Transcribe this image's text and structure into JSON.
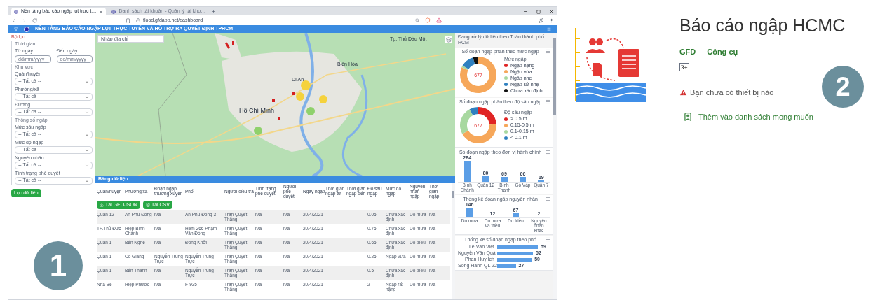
{
  "browser": {
    "tabs": [
      {
        "label": "Nền tảng báo cáo ngập lụt trực t…",
        "selected": true
      },
      {
        "label": "Danh sách tài khoản - Quản lý tài kho…",
        "selected": false
      }
    ],
    "url": "flood.gfdapp.net/dashboard"
  },
  "header": {
    "title": "NỀN TẢNG BÁO CÁO NGẬP LỤT TRỰC TUYẾN VÀ HỖ TRỢ RA QUYẾT ĐỊNH TPHCM"
  },
  "filters": {
    "title": "Bộ lọc",
    "groups": [
      {
        "title": "Thời gian",
        "kind": "dates",
        "dates": [
          {
            "label": "Từ ngày",
            "placeholder": "dd/mm/yyyy"
          },
          {
            "label": "Đến ngày",
            "placeholder": "dd/mm/yyyy"
          }
        ]
      },
      {
        "title": "Khu vực",
        "kind": "selects",
        "selects": [
          {
            "label": "Quận/huyện",
            "value": "-- Tất cả --"
          },
          {
            "label": "Phường/xã",
            "value": "-- Tất cả --"
          },
          {
            "label": "Đường",
            "value": "-- Tất cả --"
          }
        ]
      },
      {
        "title": "Thông số ngập",
        "kind": "selects",
        "selects": [
          {
            "label": "Mức sâu ngập",
            "value": "-- Tất cả --"
          },
          {
            "label": "Mức độ ngập",
            "value": "-- Tất cả --"
          },
          {
            "label": "Nguyên nhân",
            "value": "-- Tất cả --"
          },
          {
            "label": "Tình trạng phê duyệt",
            "value": "-- Tất cả --"
          }
        ]
      }
    ],
    "button": "Lọc dữ liệu"
  },
  "map": {
    "search_placeholder": "Nhập địa chỉ",
    "places": [
      "Tp. Thủ Dầu Một",
      "Biên Hòa",
      "Dĩ An",
      "Hồ Chí Minh"
    ]
  },
  "table": {
    "title": "Bảng dữ liệu",
    "columns": [
      "Quận/huyện",
      "Phường/xã",
      "Đoạn ngập thường xuyên",
      "Phố",
      "Người điều tra",
      "Tình trạng phê duyệt",
      "Người phê duyệt",
      "Ngày ngập",
      "Thời gian ngập từ",
      "Thời gian ngập đến",
      "Độ sâu ngập",
      "Mức độ ngập",
      "Nguyên nhân ngập",
      "Thời gian ngập"
    ],
    "buttons": [
      "Tải GEOJSON",
      "Tải CSV"
    ],
    "rows": [
      [
        "Quận 12",
        "An Phú Đông",
        "n/a",
        "An Phú Đông 3",
        "Trần Quyết Thắng",
        "n/a",
        "n/a",
        "20/4/2021",
        "",
        "",
        "0.05",
        "Chưa xác định",
        "Do mưa",
        "n/a"
      ],
      [
        "TP.Thủ Đức",
        "Hiệp Bình Chánh",
        "n/a",
        "Hẻm 266 Phạm Văn Đồng",
        "Trần Quyết Thắng",
        "n/a",
        "n/a",
        "20/4/2021",
        "",
        "",
        "0.75",
        "Chưa xác định",
        "Do mưa",
        "n/a"
      ],
      [
        "Quận 1",
        "Bến Nghé",
        "n/a",
        "Đồng Khởi",
        "Trần Quyết Thắng",
        "n/a",
        "n/a",
        "20/4/2021",
        "",
        "",
        "0.65",
        "Chưa xác định",
        "Do triều",
        "n/a"
      ],
      [
        "Quận 1",
        "Cô Giang",
        "Nguyễn Trung Trực",
        "Nguyễn Trung Trực",
        "Trần Quyết Thắng",
        "n/a",
        "n/a",
        "20/4/2021",
        "",
        "",
        "0.25",
        "Ngập vừa",
        "Do mưa",
        "n/a"
      ],
      [
        "Quận 1",
        "Bến Thành",
        "n/a",
        "Nguyễn Trung Trực",
        "Trần Quyết Thắng",
        "n/a",
        "n/a",
        "20/4/2021",
        "",
        "",
        "0.5",
        "Chưa xác định",
        "Do triều",
        "n/a"
      ],
      [
        "Nhà Bè",
        "Hiệp Phước",
        "n/a",
        "F-935",
        "Trần Quyết Thắng",
        "n/a",
        "n/a",
        "20/4/2021",
        "",
        "",
        "2",
        "Ngập rất nặng",
        "Do mưa",
        "n/a"
      ]
    ]
  },
  "stats": {
    "title": "Đang xử lý dữ liệu theo Toàn thành phố HCM",
    "donuts": [
      {
        "legend_title": "Mức ngập",
        "center": "677",
        "chart_data": {
          "type": "donut",
          "title": "Số đoạn ngập phân theo mức ngập",
          "legend": "right",
          "categories": [
            "Ngập nặng",
            "Ngập vừa",
            "Ngập nhẹ",
            "Ngập rất nhẹ",
            "Chưa xác định"
          ],
          "colors": [
            "#e02424",
            "#f6a75a",
            "#a8d8a0",
            "#2f80c0",
            "#111111"
          ],
          "values": [
            0,
            82,
            1.5,
            11.8,
            4.7
          ]
        }
      },
      {
        "legend_title": "Độ sâu ngập",
        "center": "677",
        "chart_data": {
          "type": "donut",
          "title": "Số đoạn ngập phân theo độ sâu ngập",
          "legend": "right",
          "categories": [
            "> 0.5 m",
            "0.15-0.5 m",
            "0.1-0.15 m",
            "< 0.1 m"
          ],
          "colors": [
            "#e02424",
            "#f6a75a",
            "#a8d8a0",
            "#2f80c0"
          ],
          "values": [
            24.2,
            42.8,
            25.1,
            7.9
          ]
        }
      }
    ],
    "bars": [
      {
        "chart_data": {
          "type": "bar",
          "title": "Số đoạn ngập theo đơn vị hành chính",
          "categories": [
            "Bình Chánh",
            "Quận 12",
            "Bình Thạnh",
            "Gò Vấp",
            "Quận 7"
          ],
          "values": [
            284,
            80,
            69,
            66,
            19
          ],
          "data_labels": true
        }
      },
      {
        "chart_data": {
          "type": "bar",
          "title": "Thống kê đoạn ngập nguyên nhân",
          "categories": [
            "Do mưa",
            "Do mưa và triều",
            "Do triều",
            "Nguyên nhân khác"
          ],
          "values": [
            146,
            12,
            67,
            2
          ],
          "data_labels": true
        }
      },
      {
        "chart_data": {
          "type": "bar",
          "orientation": "horizontal",
          "title": "Thống kê số đoạn ngập theo phố",
          "categories": [
            "Lê Văn Việt",
            "Nguyễn Văn Quá",
            "Phan Huy Ích",
            "Song Hành QL 22"
          ],
          "values": [
            59,
            52,
            50,
            27
          ],
          "data_labels": true
        }
      }
    ]
  },
  "app": {
    "title": "Báo cáo ngập HCMC",
    "developer": "GFD",
    "category": "Công cụ",
    "rating": "3+",
    "warning": "Bạn chưa có thiết bị nào",
    "wishlist": "Thêm vào danh sách mong muốn"
  },
  "callouts": [
    "1",
    "2"
  ]
}
